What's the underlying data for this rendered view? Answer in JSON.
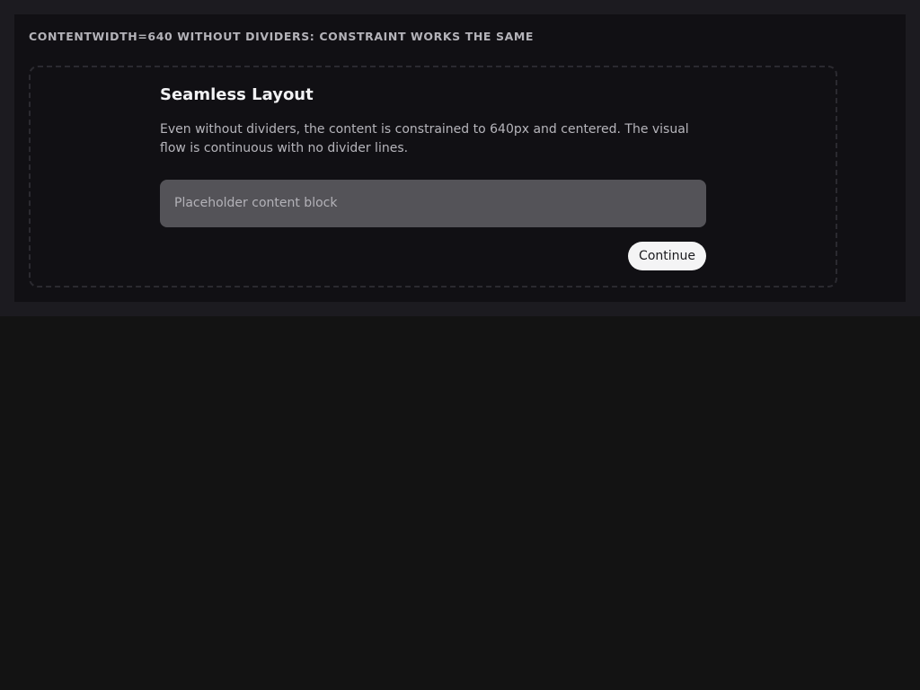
{
  "story": {
    "heading": "CONTENTWIDTH=640 WITHOUT DIVIDERS: CONSTRAINT WORKS THE SAME"
  },
  "section": {
    "title": "Seamless Layout",
    "body": "Even without dividers, the content is constrained to 640px and centered. The visual flow is continuous with no divider lines.",
    "placeholder": "Placeholder content block"
  },
  "actions": {
    "continue_label": "Continue"
  }
}
